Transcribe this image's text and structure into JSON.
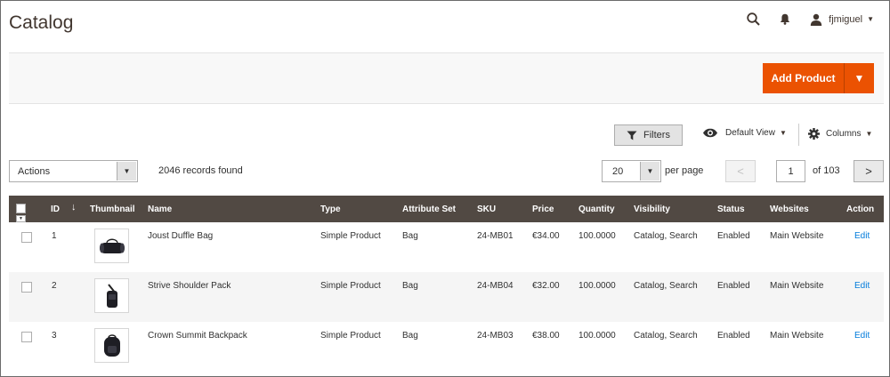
{
  "header": {
    "title": "Catalog",
    "user_name": "fjmiguel",
    "icons": {
      "search": "search-icon",
      "notifications": "bell-icon",
      "user": "user-icon"
    }
  },
  "actionbar": {
    "add_product_label": "Add Product",
    "brand_color": "#eb5202"
  },
  "toolbar": {
    "filters_label": "Filters",
    "view_label": "Default View",
    "columns_label": "Columns",
    "actions_label": "Actions",
    "records_text": "2046 records found",
    "per_page_value": "20",
    "per_page_label": "per page",
    "current_page": "1",
    "page_total_text": "of 103"
  },
  "grid": {
    "header_bg": "#514943",
    "columns": [
      "ID",
      "Thumbnail",
      "Name",
      "Type",
      "Attribute Set",
      "SKU",
      "Price",
      "Quantity",
      "Visibility",
      "Status",
      "Websites",
      "Action"
    ],
    "rows": [
      {
        "id": "1",
        "name": "Joust Duffle Bag",
        "type": "Simple Product",
        "attribute_set": "Bag",
        "sku": "24-MB01",
        "price": "€34.00",
        "quantity": "100.0000",
        "visibility": "Catalog, Search",
        "status": "Enabled",
        "websites": "Main Website",
        "action": "Edit",
        "thumbnail": "duffle-bag-image"
      },
      {
        "id": "2",
        "name": "Strive Shoulder Pack",
        "type": "Simple Product",
        "attribute_set": "Bag",
        "sku": "24-MB04",
        "price": "€32.00",
        "quantity": "100.0000",
        "visibility": "Catalog, Search",
        "status": "Enabled",
        "websites": "Main Website",
        "action": "Edit",
        "thumbnail": "shoulder-pack-image"
      },
      {
        "id": "3",
        "name": "Crown Summit Backpack",
        "type": "Simple Product",
        "attribute_set": "Bag",
        "sku": "24-MB03",
        "price": "€38.00",
        "quantity": "100.0000",
        "visibility": "Catalog, Search",
        "status": "Enabled",
        "websites": "Main Website",
        "action": "Edit",
        "thumbnail": "backpack-image"
      }
    ]
  }
}
